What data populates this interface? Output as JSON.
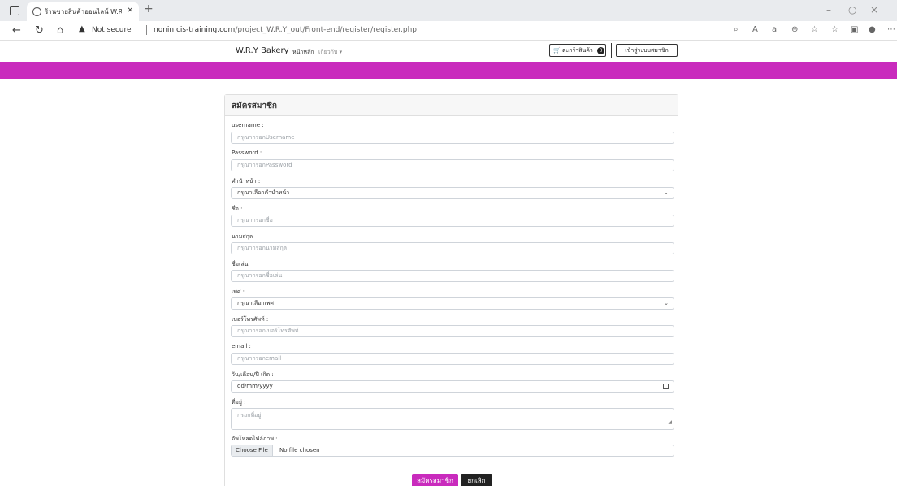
{
  "browser": {
    "tab_title": "ร้านขายสินค้าออนไลน์ W.R.Y. Bakery",
    "tab_close": "×",
    "new_tab": "+",
    "not_secure": "Not secure",
    "url_host": "nonin.cis-training.com",
    "url_path": "/project_W.R.Y_out/Front-end/register/register.php",
    "window_minimize": "–",
    "window_restore": "○",
    "window_close": "×"
  },
  "navbar": {
    "brand": "W.R.Y Bakery",
    "home": "หน้าหลัก",
    "about": "เกี่ยวกับ ▾",
    "cart_label": "ตะกร้าสินค้า",
    "cart_count": "0",
    "login": "เข้าสู่ระบบสมาชิก"
  },
  "colors": {
    "accent": "#c92bbd",
    "dark_button": "#222222"
  },
  "form": {
    "title": "สมัครสมาชิก",
    "fields": {
      "username": {
        "label": "username :",
        "placeholder": "กรุณากรอกUsername"
      },
      "password": {
        "label": "Password :",
        "placeholder": "กรุณากรอกPassword"
      },
      "prefix": {
        "label": "คำนำหน้า :",
        "value": "กรุณาเลือกคำนำหน้า"
      },
      "firstname": {
        "label": "ชื่อ :",
        "placeholder": "กรุณากรอกชื่อ"
      },
      "lastname": {
        "label": "นามสกุล",
        "placeholder": "กรุณากรอกนามสกุล"
      },
      "nickname": {
        "label": "ชื่อเล่น",
        "placeholder": "กรุณากรอกชื่อเล่น"
      },
      "gender": {
        "label": "เพศ :",
        "value": "กรุณาเลือกเพศ"
      },
      "phone": {
        "label": "เบอร์โทรศัพท์ :",
        "placeholder": "กรุณากรอกเบอร์โทรศัพท์"
      },
      "email": {
        "label": "email :",
        "placeholder": "กรุณากรอกemail"
      },
      "birthdate": {
        "label": "วัน/เดือน/ปี เกิด :",
        "placeholder": "dd/mm/yyyy"
      },
      "address": {
        "label": "ที่อยู่ :",
        "placeholder": "กรอกที่อยู่"
      },
      "photo": {
        "label": "อัพโหลดไฟล์ภาพ :",
        "button": "Choose File",
        "status": "No file chosen"
      }
    },
    "submit": "สมัครสมาชิก",
    "cancel": "ยกเลิก"
  }
}
